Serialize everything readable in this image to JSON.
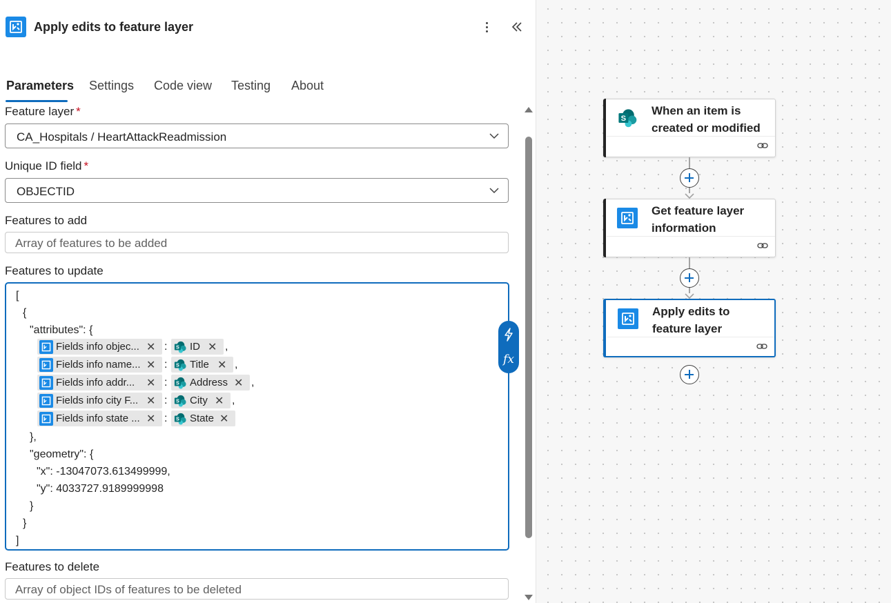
{
  "header": {
    "title": "Apply edits to feature layer",
    "icon": "arcgis-connector-icon",
    "more_icon": "more-vertical-icon",
    "collapse_icon": "double-chevron-left-icon"
  },
  "tabs": [
    {
      "label": "Parameters",
      "active": true
    },
    {
      "label": "Settings",
      "active": false
    },
    {
      "label": "Code view",
      "active": false
    },
    {
      "label": "Testing",
      "active": false
    },
    {
      "label": "About",
      "active": false
    }
  ],
  "fields": {
    "feature_layer": {
      "label": "Feature layer",
      "required_mark": "*",
      "value": "CA_Hospitals / HeartAttackReadmission"
    },
    "unique_id": {
      "label": "Unique ID field",
      "required_mark": "*",
      "value": "OBJECTID"
    },
    "features_add": {
      "label": "Features to add",
      "placeholder": "Array of features to be added"
    },
    "features_update": {
      "label": "Features to update"
    },
    "features_delete": {
      "label": "Features to delete",
      "placeholder": "Array of object IDs of features to be deleted"
    }
  },
  "editor": {
    "open_bracket": "[",
    "open_brace": "{",
    "attributes_line": "\"attributes\": {",
    "rows": [
      {
        "left": "Fields info objec...",
        "right": "ID",
        "sep": ":",
        "trail": ","
      },
      {
        "left": "Fields info name...",
        "right": "Title",
        "sep": ":",
        "trail": ","
      },
      {
        "left": "Fields info addr...",
        "right": "Address",
        "sep": ":",
        "trail": ","
      },
      {
        "left": "Fields info city F...",
        "right": "City",
        "sep": ":",
        "trail": ","
      },
      {
        "left": "Fields info state ...",
        "right": "State",
        "sep": ":",
        "trail": ""
      }
    ],
    "close_attr": "},",
    "geometry_line": "\"geometry\": {",
    "x_line": "\"x\": -13047073.613499999,",
    "y_line": "\"y\": 4033727.9189999998",
    "close_geom": "}",
    "close_brace": "}",
    "close_bracket": "]",
    "remove_glyph": "✕"
  },
  "expression_buttons": {
    "dynamic_icon": "lightning-icon",
    "fx_label": "fx"
  },
  "flow": {
    "cards": [
      {
        "title": "When an item is created or modified",
        "icon": "sharepoint-icon",
        "selected": false
      },
      {
        "title": "Get feature layer information",
        "icon": "arcgis-connector-icon",
        "selected": false
      },
      {
        "title": "Apply edits to feature layer",
        "icon": "arcgis-connector-icon",
        "selected": true
      }
    ],
    "link_icon": "link-icon",
    "add_icon": "plus-icon"
  },
  "colors": {
    "accent": "#0f6cbd",
    "arcgis": "#1a8ae6",
    "sharepoint": "#038387",
    "required": "#c50f1f"
  }
}
